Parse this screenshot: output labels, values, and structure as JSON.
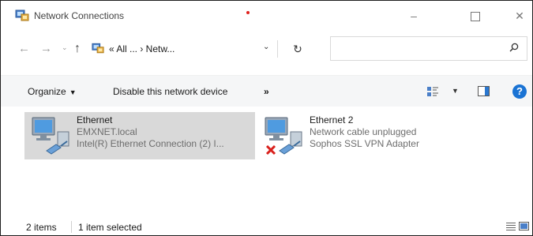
{
  "window": {
    "title": "Network Connections",
    "icon": "network-connections-icon",
    "controls": {
      "minimize": "–",
      "close": "✕"
    }
  },
  "nav": {
    "back_icon": "arrow-left-icon",
    "forward_icon": "arrow-right-icon",
    "up_icon": "arrow-up-icon",
    "address_path": "« All ... › Netw...",
    "refresh_icon": "refresh-icon",
    "search_placeholder": ""
  },
  "commandbar": {
    "organize_label": "Organize",
    "disable_label": "Disable this network device",
    "more_label": "»"
  },
  "items": [
    {
      "name": "Ethernet",
      "status": "EMXNET.local",
      "adapter": "Intel(R) Ethernet Connection (2) I...",
      "selected": true,
      "disconnected": false
    },
    {
      "name": "Ethernet 2",
      "status": "Network cable unplugged",
      "adapter": "Sophos SSL VPN Adapter",
      "selected": false,
      "disconnected": true
    }
  ],
  "statusbar": {
    "item_count": "2 items",
    "selection": "1 item selected"
  },
  "colors": {
    "selection": "#d9d9d9",
    "help_blue": "#1a73d4",
    "error_red": "#d9201c",
    "notification_dot": "#e0201c"
  }
}
